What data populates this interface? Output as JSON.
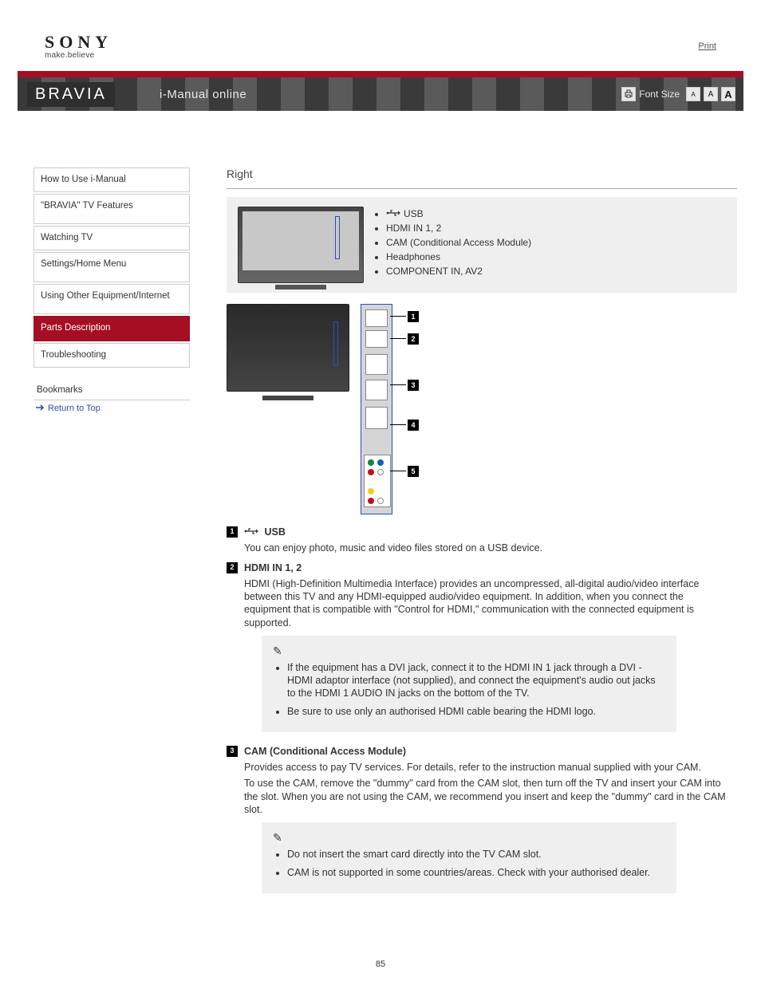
{
  "brand": {
    "sony": "SONY",
    "tagline": "make.believe",
    "bravia": "BRAVIA",
    "guide": "i-Manual online",
    "print_link": "Print"
  },
  "topbar": {
    "font_label": "Font Size",
    "font_a1": "A",
    "font_a2": "A",
    "font_a3": "A"
  },
  "nav": {
    "items": [
      {
        "label": "How to Use i-Manual",
        "active": false
      },
      {
        "label": "\"BRAVIA\" TV Features",
        "active": false
      },
      {
        "label": "Watching TV",
        "active": false
      },
      {
        "label": "Settings/Home Menu",
        "active": false
      },
      {
        "label": "Using Other Equipment/Internet",
        "active": false
      },
      {
        "label": "Parts Description",
        "active": true
      },
      {
        "label": "Troubleshooting",
        "active": false
      }
    ],
    "sub_heading": "Bookmarks",
    "sub_link": "Return to Top"
  },
  "page": {
    "title": "Right",
    "port_list": [
      "USB",
      "HDMI IN 1, 2",
      "CAM (Conditional Access Module)",
      "Headphones",
      "COMPONENT IN, AV2"
    ],
    "definitions": [
      {
        "num": "1",
        "label_glyph": "usb",
        "label": "USB",
        "text": "You can enjoy photo, music and video files stored on a USB device."
      },
      {
        "num": "2",
        "label": "HDMI IN 1, 2",
        "text": "HDMI (High-Definition Multimedia Interface) provides an uncompressed, all-digital audio/video interface between this TV and any HDMI-equipped audio/video equipment. In addition, when you connect the equipment that is compatible with \"Control for HDMI,\" communication with the connected equipment is supported.",
        "notes": [
          "If the equipment has a DVI jack, connect it to the HDMI IN 1 jack through a DVI - HDMI adaptor interface (not supplied), and connect the equipment's audio out jacks to the HDMI 1 AUDIO IN jacks on the bottom of the TV.",
          "Be sure to use only an authorised HDMI cable bearing the HDMI logo."
        ]
      },
      {
        "num": "3",
        "label": "CAM (Conditional Access Module)",
        "text": "Provides access to pay TV services. For details, refer to the instruction manual supplied with your CAM.",
        "text2": "To use the CAM, remove the \"dummy\" card from the CAM slot, then turn off the TV and insert your CAM into the slot. When you are not using the CAM, we recommend you insert and keep the \"dummy\" card in the CAM slot.",
        "notes": [
          "Do not insert the smart card directly into the TV CAM slot.",
          "CAM is not supported in some countries/areas. Check with your authorised dealer."
        ]
      }
    ],
    "page_number": "85"
  }
}
